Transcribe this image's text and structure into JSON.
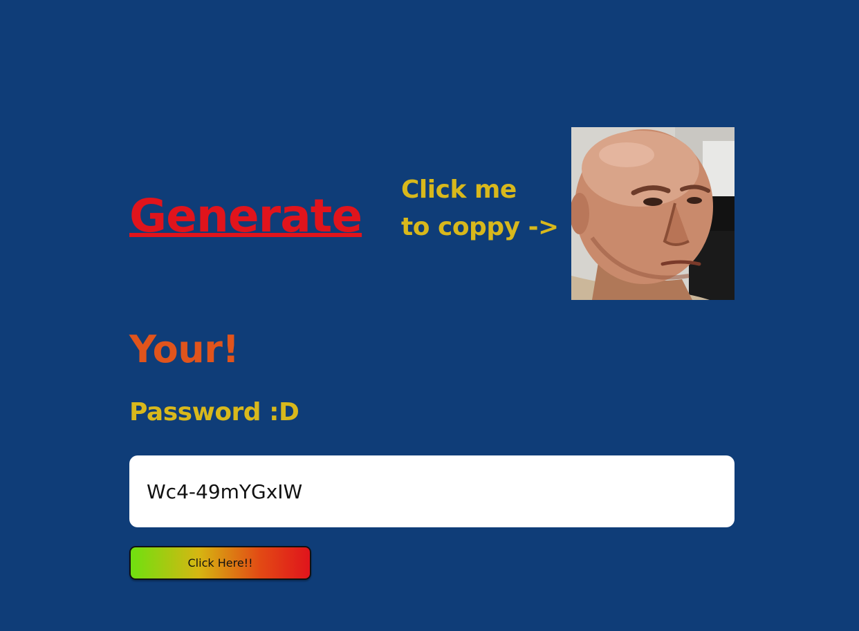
{
  "header": {
    "generate_label": "Generate",
    "copy_hint_line1": "Click me",
    "copy_hint_line2": "to coppy ->"
  },
  "result": {
    "heading": "Your!",
    "label": "Password :D",
    "password_value": "Wc4-49mYGxIW"
  },
  "button": {
    "label": "Click Here!!"
  },
  "colors": {
    "background": "#0f3d78",
    "generate": "#e0141c",
    "accent_yellow": "#d8b81c",
    "heading_orange": "#e0541c"
  }
}
